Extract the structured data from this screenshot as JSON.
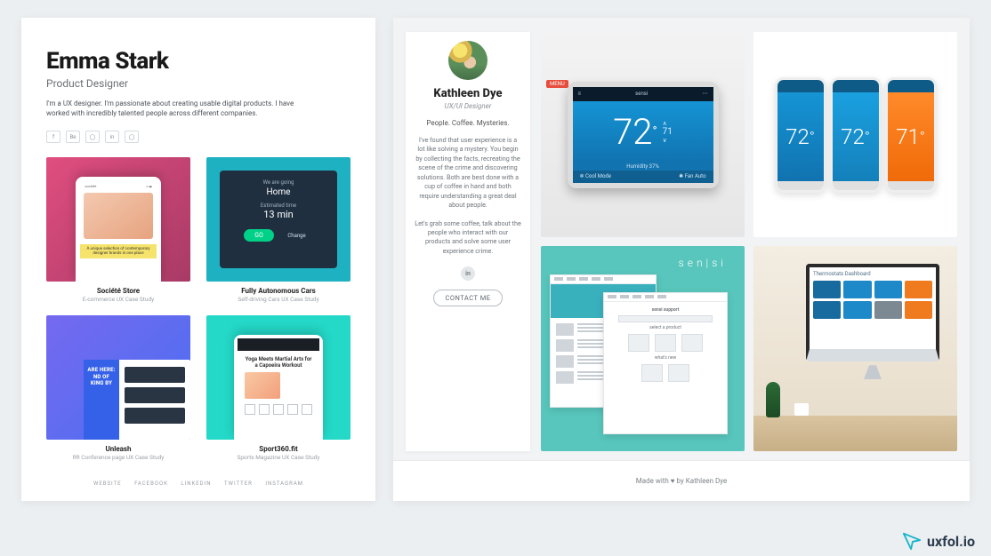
{
  "left": {
    "name": "Emma Stark",
    "role": "Product Designer",
    "bio": "I'm a UX designer. I'm passionate about creating usable digital products. I have worked with incredibly talented people across different companies.",
    "social": [
      "f",
      "Be",
      "◯",
      "in",
      "◯"
    ],
    "projects": [
      {
        "title": "Société Store",
        "subtitle": "E-commerce UX Case Study",
        "mock": {
          "brand": "société",
          "strip": "A unique selection of contemporary designer brands in one place"
        }
      },
      {
        "title": "Fully Autonomous Cars",
        "subtitle": "Self-driving Cars UX Case Study",
        "mock": {
          "line1": "We are going",
          "line2_value": "Home",
          "line3": "Estimated time",
          "line4_value": "13 min",
          "cta": "GO",
          "cta2": "Change"
        }
      },
      {
        "title": "Unleash",
        "subtitle": "RR Conference page UX Case Study",
        "mock": {
          "headline": "ARE HERE:\nND OF\nKING BY"
        }
      },
      {
        "title": "Sport360.fit",
        "subtitle": "Sports Magazine UX Case Study",
        "mock": {
          "headline": "Yoga Meets Martial Arts for a Capoeira Workout"
        }
      }
    ],
    "footer": [
      "WEBSITE",
      "FACEBOOK",
      "LINKEDIN",
      "TWITTER",
      "INSTAGRAM"
    ]
  },
  "right": {
    "name": "Kathleen Dye",
    "role": "UX/UI Designer",
    "tagline": "People. Coffee. Mysteries.",
    "para1": "I've found that user experience is a lot like solving a mystery. You begin by collecting the facts, recreating the scene of the crime and discovering solutions. Both are best done with a cup of coffee in hand and both require understanding a great deal about people.",
    "para2": "Let's grab some coffee, talk about the people who interact with our products and solve some user experience crime.",
    "social_icon": "in",
    "contact": "CONTACT ME",
    "thermo": {
      "brand": "sensi",
      "menu": "MENU",
      "temp": "72",
      "deg": "°",
      "target": "71",
      "humidity": "Humidity 37%",
      "mode": "Cool Mode",
      "fan": "Fan Auto"
    },
    "phones": [
      "72",
      "72",
      "71"
    ],
    "sensi_logo": "sen|si",
    "winB": {
      "h1": "sensi support",
      "h2": "select a product",
      "h3": "what's new"
    },
    "dashboard_title": "Thermostats Dashboard",
    "footer": "Made with ♥ by Kathleen Dye"
  },
  "watermark": "uxfol.io"
}
